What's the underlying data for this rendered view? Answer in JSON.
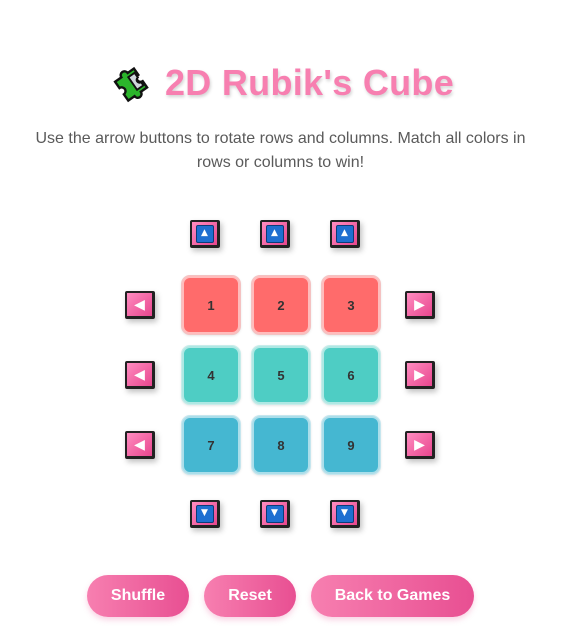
{
  "title": {
    "icon": "puzzle-piece-icon",
    "text": "2D Rubik's Cube",
    "color": "#f77fb0"
  },
  "subtitle": "Use the arrow buttons to rotate rows and columns. Match all colors in rows or columns to win!",
  "controls": {
    "up_arrow": "▲",
    "down_arrow": "▼",
    "left_arrow": "◀",
    "right_arrow": "▶"
  },
  "grid": {
    "rows": [
      [
        "1",
        "2",
        "3"
      ],
      [
        "4",
        "5",
        "6"
      ],
      [
        "7",
        "8",
        "9"
      ]
    ],
    "row_colors": [
      "#ff6b6b",
      "#4ecdc4",
      "#45b7d1"
    ]
  },
  "buttons": {
    "shuffle": "Shuffle",
    "reset": "Reset",
    "back": "Back to Games"
  },
  "accent": "#e84f92"
}
